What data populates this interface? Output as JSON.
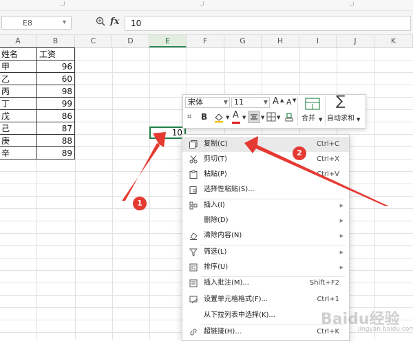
{
  "formula_bar": {
    "cell_ref": "E8",
    "formula_symbol": "fx",
    "value": "10"
  },
  "columns": [
    "A",
    "B",
    "C",
    "D",
    "E",
    "F",
    "G",
    "H",
    "I",
    "J",
    "K"
  ],
  "table": {
    "headers": [
      "姓名",
      "工资"
    ],
    "rows": [
      {
        "name": "甲",
        "salary": "96"
      },
      {
        "name": "乙",
        "salary": "60"
      },
      {
        "name": "丙",
        "salary": "98"
      },
      {
        "name": "丁",
        "salary": "99"
      },
      {
        "name": "戊",
        "salary": "86"
      },
      {
        "name": "己",
        "salary": "87"
      },
      {
        "name": "庚",
        "salary": "88"
      },
      {
        "name": "辛",
        "salary": "89"
      }
    ]
  },
  "active_cell_value": "10",
  "mini_toolbar": {
    "font_name": "宋体",
    "font_size": "11",
    "bold_label": "B",
    "font_color_label": "A",
    "merge_label": "合并",
    "autosum_label": "自动求和",
    "sigma": "∑",
    "grow_font": "A",
    "shrink_font": "A"
  },
  "context_menu": {
    "items": [
      {
        "label": "复制(C)",
        "shortcut": "Ctrl+C",
        "icon": "copy-icon"
      },
      {
        "label": "剪切(T)",
        "shortcut": "Ctrl+X",
        "icon": "scissors-icon"
      },
      {
        "label": "粘贴(P)",
        "shortcut": "Ctrl+V",
        "icon": "paste-icon"
      },
      {
        "label": "选择性粘贴(S)...",
        "shortcut": "",
        "icon": "paste-special-icon"
      },
      {
        "label": "插入(I)",
        "shortcut": "",
        "icon": "insert-icon"
      },
      {
        "label": "删除(D)",
        "shortcut": "",
        "icon": ""
      },
      {
        "label": "清除内容(N)",
        "shortcut": "",
        "icon": "eraser-icon"
      },
      {
        "label": "筛选(L)",
        "shortcut": "",
        "icon": "filter-icon"
      },
      {
        "label": "排序(U)",
        "shortcut": "",
        "icon": "sort-icon"
      },
      {
        "label": "插入批注(M)...",
        "shortcut": "Shift+F2",
        "icon": "comment-icon"
      },
      {
        "label": "设置单元格格式(F)...",
        "shortcut": "Ctrl+1",
        "icon": "format-cells-icon"
      },
      {
        "label": "从下拉列表中选择(K)...",
        "shortcut": "",
        "icon": ""
      },
      {
        "label": "超链接(H)...",
        "shortcut": "Ctrl+K",
        "icon": "link-icon"
      }
    ]
  },
  "annotations": {
    "badge_1": "1",
    "badge_2": "2",
    "color": "#e53a32"
  },
  "watermark": {
    "text": "Baidu经验",
    "sub": "jingyan.baidu.com"
  }
}
